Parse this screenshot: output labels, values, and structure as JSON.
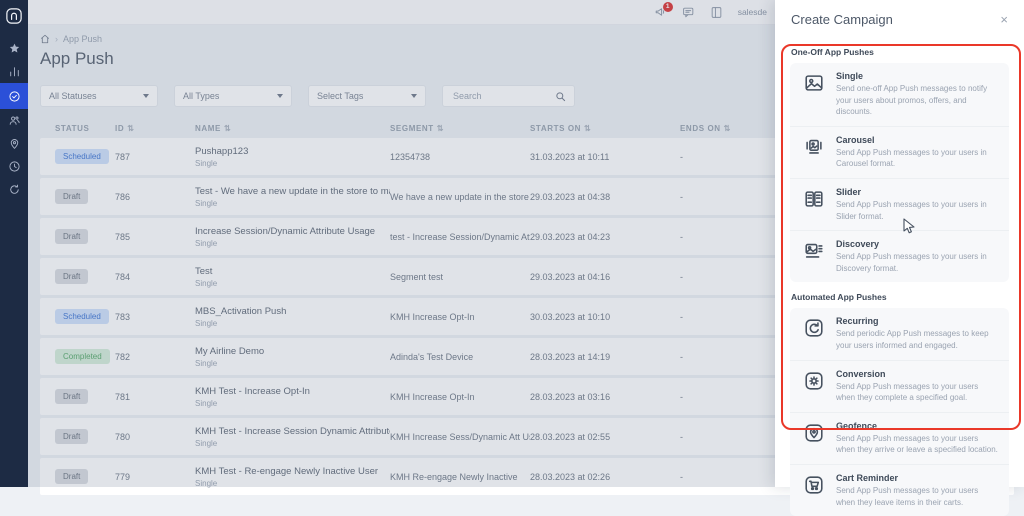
{
  "sidebar": {
    "logo_letter": "n",
    "items": [
      {
        "name": "favorites",
        "icon": "star-icon",
        "active": false
      },
      {
        "name": "analytics",
        "icon": "bar-chart-icon",
        "active": false
      },
      {
        "name": "campaigns",
        "icon": "target-check-icon",
        "active": true
      },
      {
        "name": "audience",
        "icon": "users-icon",
        "active": false
      },
      {
        "name": "geolocation",
        "icon": "location-pin-icon",
        "active": false
      },
      {
        "name": "history",
        "icon": "clock-icon",
        "active": false
      },
      {
        "name": "sync",
        "icon": "refresh-icon",
        "active": false
      }
    ]
  },
  "topbar": {
    "notification_count": "1",
    "icons": [
      {
        "name": "notifications-icon"
      },
      {
        "name": "feedback-icon"
      },
      {
        "name": "guide-icon"
      }
    ],
    "account_text": "salesde"
  },
  "breadcrumb": {
    "separator": "›",
    "current": "App Push"
  },
  "page": {
    "title": "App Push"
  },
  "filters": {
    "status": "All Statuses",
    "type": "All Types",
    "tags": "Select Tags",
    "search_placeholder": "Search"
  },
  "table": {
    "sort_glyph": "⇅",
    "columns": [
      {
        "label": "STATUS",
        "sortable": false
      },
      {
        "label": "ID",
        "sortable": true
      },
      {
        "label": "NAME",
        "sortable": true
      },
      {
        "label": "SEGMENT",
        "sortable": true
      },
      {
        "label": "STARTS ON",
        "sortable": true
      },
      {
        "label": "ENDS ON",
        "sortable": true
      }
    ],
    "rows": [
      {
        "status": "Scheduled",
        "status_type": "scheduled",
        "id": "787",
        "name": "Pushapp123",
        "type": "Single",
        "segment": "12354738",
        "starts_on": "31.03.2023 at 10:11",
        "ends_on": "-"
      },
      {
        "status": "Draft",
        "status_type": "draft",
        "id": "786",
        "name": "Test - We have a new update in the store to make y...",
        "type": "Single",
        "segment": "We have a new update in the store to ...",
        "starts_on": "29.03.2023 at 04:38",
        "ends_on": "-"
      },
      {
        "status": "Draft",
        "status_type": "draft",
        "id": "785",
        "name": "Increase Session/Dynamic Attribute Usage",
        "type": "Single",
        "segment": "test - Increase Session/Dynamic Attrib...",
        "starts_on": "29.03.2023 at 04:23",
        "ends_on": "-"
      },
      {
        "status": "Draft",
        "status_type": "draft",
        "id": "784",
        "name": "Test",
        "type": "Single",
        "segment": "Segment test",
        "starts_on": "29.03.2023 at 04:16",
        "ends_on": "-"
      },
      {
        "status": "Scheduled",
        "status_type": "scheduled",
        "id": "783",
        "name": "MBS_Activation Push",
        "type": "Single",
        "segment": "KMH Increase Opt-In",
        "starts_on": "30.03.2023 at 10:10",
        "ends_on": "-"
      },
      {
        "status": "Completed",
        "status_type": "completed",
        "id": "782",
        "name": "My Airline Demo",
        "type": "Single",
        "segment": "Adinda's Test Device",
        "starts_on": "28.03.2023 at 14:19",
        "ends_on": "-"
      },
      {
        "status": "Draft",
        "status_type": "draft",
        "id": "781",
        "name": "KMH Test - Increase Opt-In",
        "type": "Single",
        "segment": "KMH Increase Opt-In",
        "starts_on": "28.03.2023 at 03:16",
        "ends_on": "-"
      },
      {
        "status": "Draft",
        "status_type": "draft",
        "id": "780",
        "name": "KMH Test - Increase Session Dynamic Attribute Usa...",
        "type": "Single",
        "segment": "KMH Increase Sess/Dynamic Att Usage",
        "starts_on": "28.03.2023 at 02:55",
        "ends_on": "-"
      },
      {
        "status": "Draft",
        "status_type": "draft",
        "id": "779",
        "name": "KMH Test - Re-engage Newly Inactive User",
        "type": "Single",
        "segment": "KMH Re-engage Newly Inactive",
        "starts_on": "28.03.2023 at 02:26",
        "ends_on": "-"
      }
    ]
  },
  "drawer": {
    "title": "Create Campaign",
    "close_glyph": "×",
    "sections": [
      {
        "label": "One-Off App Pushes",
        "items": [
          {
            "icon": "single-image-icon",
            "title": "Single",
            "description": "Send one-off App Push messages to notify your users about promos, offers, and discounts."
          },
          {
            "icon": "carousel-icon",
            "title": "Carousel",
            "description": "Send App Push messages to your users in Carousel format."
          },
          {
            "icon": "slider-icon",
            "title": "Slider",
            "description": "Send App Push messages to your users in Slider format."
          },
          {
            "icon": "discovery-icon",
            "title": "Discovery",
            "description": "Send App Push messages to your users in Discovery format."
          }
        ]
      },
      {
        "label": "Automated App Pushes",
        "items": [
          {
            "icon": "recurring-icon",
            "title": "Recurring",
            "description": "Send periodic App Push messages to keep your users informed and engaged."
          },
          {
            "icon": "conversion-icon",
            "title": "Conversion",
            "description": "Send App Push messages to your users when they complete a specified goal."
          },
          {
            "icon": "geofence-icon",
            "title": "Geofence",
            "description": "Send App Push messages to your users when they arrive or leave a specified location."
          },
          {
            "icon": "cart-reminder-icon",
            "title": "Cart Reminder",
            "description": "Send App Push messages to your users when they leave items in their carts."
          }
        ]
      }
    ]
  },
  "colors": {
    "sidebar_bg": "#1d2b44",
    "active_item_blue": "#2b50d8",
    "annotation_red": "#ea3829",
    "scheduled_badge": "#cfe0fb",
    "scheduled_text": "#3c74d4",
    "draft_badge": "#d9dce1",
    "draft_text": "#6b7480",
    "completed_badge": "#d5edda",
    "completed_text": "#55a868",
    "notification_badge": "#dd3030"
  }
}
